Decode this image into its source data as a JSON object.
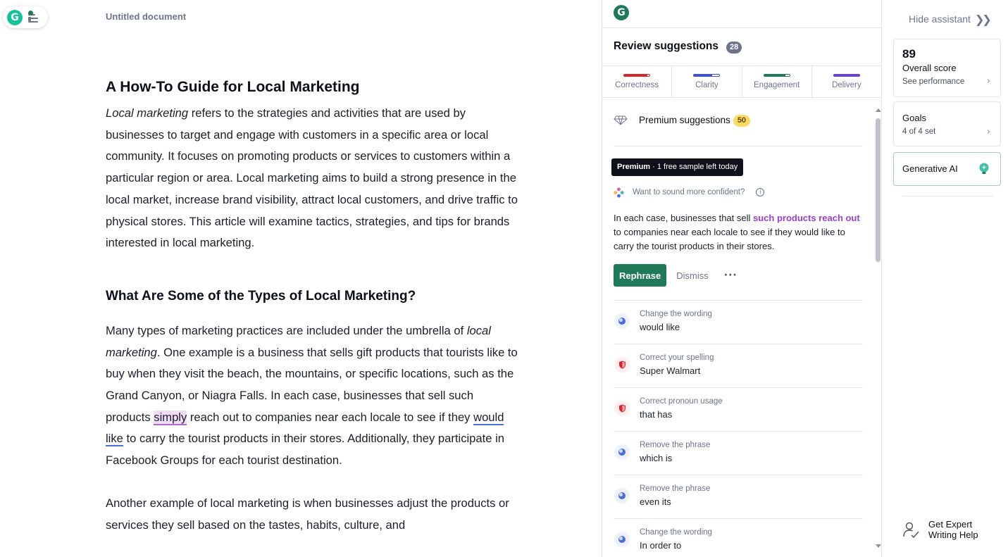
{
  "editor": {
    "doc_title": "Untitled document",
    "h1": "A How-To Guide for Local Marketing",
    "p1": {
      "italic": "Local marketing",
      "rest": " refers to the strategies and activities that are used by businesses to target and engage with customers in a specific area or local community. It focuses on promoting products or services to customers within a particular region or area. Local marketing aims to build a strong presence in the local market, increase brand visibility, attract local customers, and drive traffic to physical stores. This article will examine tactics, strategies, and tips for brands interested in local marketing."
    },
    "h2": "What Are Some of the Types of Local Marketing?",
    "p2": {
      "a": "Many types of marketing practices are included under the umbrella of ",
      "italic": "local marketing",
      "b": ". One example is a business that sells gift products that tourists like to buy when they visit the beach, the mountains, or specific locations, such as the Grand Canyon, or Niagra Falls. In each case, businesses that sell such products ",
      "flag1": "simply",
      "c": " reach out to companies near each locale to see if they ",
      "flag2": "would like",
      "d": " to carry the tourist products in their stores. Additionally, they participate in Facebook Groups for each tourist destination."
    },
    "p3": "Another example of local marketing is when businesses adjust the products or services they sell based on the tastes, habits, culture, and"
  },
  "panel": {
    "review_title": "Review suggestions",
    "review_count": "28",
    "categories": [
      {
        "label": "Correctness",
        "color": "#d9252d",
        "fill": 0.9
      },
      {
        "label": "Clarity",
        "color": "#3f51d8",
        "fill": 0.7
      },
      {
        "label": "Engagement",
        "color": "#1f7a5a",
        "fill": 0.85
      },
      {
        "label": "Delivery",
        "color": "#6b3fd8",
        "fill": 1.0
      }
    ],
    "premium_label": "Premium suggestions",
    "premium_count": "50",
    "tooltip": {
      "bold": "Premium",
      "rest": " · 1 free sample left today"
    },
    "confident_label": "Want to sound more confident?",
    "sample": {
      "a": "In each case, businesses that sell ",
      "hl": "such products reach out",
      "b": " to companies near each locale to see if they would like to carry the tourist products in their stores."
    },
    "rephrase_label": "Rephrase",
    "dismiss_label": "Dismiss",
    "more_label": "···",
    "items": [
      {
        "type": "clarity",
        "category": "Change the wording",
        "value": "would like"
      },
      {
        "type": "correct",
        "category": "Correct your spelling",
        "value": "Super Walmart"
      },
      {
        "type": "correct",
        "category": "Correct pronoun usage",
        "value": "that has"
      },
      {
        "type": "clarity",
        "category": "Remove the phrase",
        "value": "which is"
      },
      {
        "type": "clarity",
        "category": "Remove the phrase",
        "value": "even its"
      },
      {
        "type": "clarity",
        "category": "Change the wording",
        "value": "In order to"
      }
    ]
  },
  "rail": {
    "hide_label": "Hide assistant",
    "score": "89",
    "score_label": "Overall score",
    "score_sub": "See performance",
    "goals_label": "Goals",
    "goals_sub": "4 of 4 set",
    "ai_label": "Generative AI",
    "expert_label": "Get Expert Writing Help"
  }
}
